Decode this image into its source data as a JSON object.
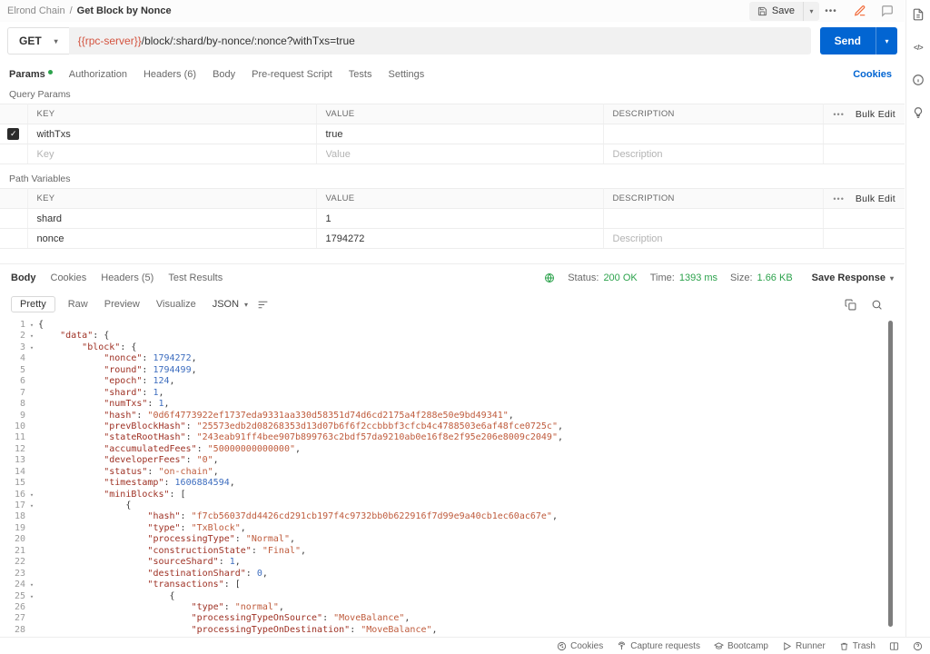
{
  "glyphs": {
    "chevron_down": "▾",
    "check": "✓"
  },
  "header": {
    "collection": "Elrond Chain",
    "separator": "/",
    "request_name": "Get Block by Nonce",
    "save_label": "Save",
    "more_label": "•••"
  },
  "request": {
    "method": "GET",
    "url_variable": "{{rpc-server}}",
    "url_path": "/block/:shard/by-nonce/:nonce?withTxs=true",
    "send_label": "Send",
    "cookies_link": "Cookies"
  },
  "request_tabs": [
    {
      "label": "Params",
      "active": true
    },
    {
      "label": "Authorization",
      "active": false
    },
    {
      "label": "Headers (6)",
      "active": false
    },
    {
      "label": "Body",
      "active": false
    },
    {
      "label": "Pre-request Script",
      "active": false
    },
    {
      "label": "Tests",
      "active": false
    },
    {
      "label": "Settings",
      "active": false
    }
  ],
  "query_params": {
    "title": "Query Params",
    "col_key": "KEY",
    "col_value": "VALUE",
    "col_description": "DESCRIPTION",
    "more_label": "•••",
    "bulk_edit_label": "Bulk Edit",
    "rows": [
      {
        "key": "withTxs",
        "value": "true",
        "description": "",
        "checked": true
      }
    ],
    "placeholders": {
      "key": "Key",
      "value": "Value",
      "description": "Description"
    }
  },
  "path_variables": {
    "title": "Path Variables",
    "col_key": "KEY",
    "col_value": "VALUE",
    "col_description": "DESCRIPTION",
    "more_label": "•••",
    "bulk_edit_label": "Bulk Edit",
    "rows": [
      {
        "key": "shard",
        "value": "1",
        "description": ""
      },
      {
        "key": "nonce",
        "value": "1794272",
        "description_placeholder": "Description"
      }
    ]
  },
  "response": {
    "tabs": [
      {
        "label": "Body",
        "active": true
      },
      {
        "label": "Cookies",
        "active": false
      },
      {
        "label": "Headers (5)",
        "active": false
      },
      {
        "label": "Test Results",
        "active": false
      }
    ],
    "status_label": "Status:",
    "status_value": "200 OK",
    "time_label": "Time:",
    "time_value": "1393 ms",
    "size_label": "Size:",
    "size_value": "1.66 KB",
    "save_response_label": "Save Response",
    "view_modes": [
      "Pretty",
      "Raw",
      "Preview",
      "Visualize"
    ],
    "active_view": "Pretty",
    "format": "JSON"
  },
  "colors": {
    "accent_blue": "#0265d2",
    "success_green": "#2ca24c",
    "variable_orange": "#d3533f",
    "json_key": "#9e3023",
    "json_string": "#bf5b3c",
    "json_number": "#3d6dbf"
  },
  "response_body": {
    "lines": [
      {
        "n": 1,
        "fold": true,
        "t": [
          [
            "p",
            "{"
          ]
        ]
      },
      {
        "n": 2,
        "fold": true,
        "t": [
          [
            "w",
            "    "
          ],
          [
            "k",
            "\"data\""
          ],
          [
            "p",
            ": {"
          ]
        ]
      },
      {
        "n": 3,
        "fold": true,
        "t": [
          [
            "w",
            "        "
          ],
          [
            "k",
            "\"block\""
          ],
          [
            "p",
            ": {"
          ]
        ]
      },
      {
        "n": 4,
        "t": [
          [
            "w",
            "            "
          ],
          [
            "k",
            "\"nonce\""
          ],
          [
            "p",
            ": "
          ],
          [
            "n",
            "1794272"
          ],
          [
            "p",
            ","
          ]
        ]
      },
      {
        "n": 5,
        "t": [
          [
            "w",
            "            "
          ],
          [
            "k",
            "\"round\""
          ],
          [
            "p",
            ": "
          ],
          [
            "n",
            "1794499"
          ],
          [
            "p",
            ","
          ]
        ]
      },
      {
        "n": 6,
        "t": [
          [
            "w",
            "            "
          ],
          [
            "k",
            "\"epoch\""
          ],
          [
            "p",
            ": "
          ],
          [
            "n",
            "124"
          ],
          [
            "p",
            ","
          ]
        ]
      },
      {
        "n": 7,
        "t": [
          [
            "w",
            "            "
          ],
          [
            "k",
            "\"shard\""
          ],
          [
            "p",
            ": "
          ],
          [
            "n",
            "1"
          ],
          [
            "p",
            ","
          ]
        ]
      },
      {
        "n": 8,
        "t": [
          [
            "w",
            "            "
          ],
          [
            "k",
            "\"numTxs\""
          ],
          [
            "p",
            ": "
          ],
          [
            "n",
            "1"
          ],
          [
            "p",
            ","
          ]
        ]
      },
      {
        "n": 9,
        "t": [
          [
            "w",
            "            "
          ],
          [
            "k",
            "\"hash\""
          ],
          [
            "p",
            ": "
          ],
          [
            "s",
            "\"0d6f4773922ef1737eda9331aa330d58351d74d6cd2175a4f288e50e9bd49341\""
          ],
          [
            "p",
            ","
          ]
        ]
      },
      {
        "n": 10,
        "t": [
          [
            "w",
            "            "
          ],
          [
            "k",
            "\"prevBlockHash\""
          ],
          [
            "p",
            ": "
          ],
          [
            "s",
            "\"25573edb2d08268353d13d07b6f6f2ccbbbf3cfcb4c4788503e6af48fce0725c\""
          ],
          [
            "p",
            ","
          ]
        ]
      },
      {
        "n": 11,
        "t": [
          [
            "w",
            "            "
          ],
          [
            "k",
            "\"stateRootHash\""
          ],
          [
            "p",
            ": "
          ],
          [
            "s",
            "\"243eab91ff4bee907b899763c2bdf57da9210ab0e16f8e2f95e206e8009c2049\""
          ],
          [
            "p",
            ","
          ]
        ]
      },
      {
        "n": 12,
        "t": [
          [
            "w",
            "            "
          ],
          [
            "k",
            "\"accumulatedFees\""
          ],
          [
            "p",
            ": "
          ],
          [
            "s",
            "\"50000000000000\""
          ],
          [
            "p",
            ","
          ]
        ]
      },
      {
        "n": 13,
        "t": [
          [
            "w",
            "            "
          ],
          [
            "k",
            "\"developerFees\""
          ],
          [
            "p",
            ": "
          ],
          [
            "s",
            "\"0\""
          ],
          [
            "p",
            ","
          ]
        ]
      },
      {
        "n": 14,
        "t": [
          [
            "w",
            "            "
          ],
          [
            "k",
            "\"status\""
          ],
          [
            "p",
            ": "
          ],
          [
            "s",
            "\"on-chain\""
          ],
          [
            "p",
            ","
          ]
        ]
      },
      {
        "n": 15,
        "t": [
          [
            "w",
            "            "
          ],
          [
            "k",
            "\"timestamp\""
          ],
          [
            "p",
            ": "
          ],
          [
            "n",
            "1606884594"
          ],
          [
            "p",
            ","
          ]
        ]
      },
      {
        "n": 16,
        "fold": true,
        "t": [
          [
            "w",
            "            "
          ],
          [
            "k",
            "\"miniBlocks\""
          ],
          [
            "p",
            ": ["
          ]
        ]
      },
      {
        "n": 17,
        "fold": true,
        "t": [
          [
            "w",
            "                "
          ],
          [
            "p",
            "{"
          ]
        ]
      },
      {
        "n": 18,
        "t": [
          [
            "w",
            "                    "
          ],
          [
            "k",
            "\"hash\""
          ],
          [
            "p",
            ": "
          ],
          [
            "s",
            "\"f7cb56037dd4426cd291cb197f4c9732bb0b622916f7d99e9a40cb1ec60ac67e\""
          ],
          [
            "p",
            ","
          ]
        ]
      },
      {
        "n": 19,
        "t": [
          [
            "w",
            "                    "
          ],
          [
            "k",
            "\"type\""
          ],
          [
            "p",
            ": "
          ],
          [
            "s",
            "\"TxBlock\""
          ],
          [
            "p",
            ","
          ]
        ]
      },
      {
        "n": 20,
        "t": [
          [
            "w",
            "                    "
          ],
          [
            "k",
            "\"processingType\""
          ],
          [
            "p",
            ": "
          ],
          [
            "s",
            "\"Normal\""
          ],
          [
            "p",
            ","
          ]
        ]
      },
      {
        "n": 21,
        "t": [
          [
            "w",
            "                    "
          ],
          [
            "k",
            "\"constructionState\""
          ],
          [
            "p",
            ": "
          ],
          [
            "s",
            "\"Final\""
          ],
          [
            "p",
            ","
          ]
        ]
      },
      {
        "n": 22,
        "t": [
          [
            "w",
            "                    "
          ],
          [
            "k",
            "\"sourceShard\""
          ],
          [
            "p",
            ": "
          ],
          [
            "n",
            "1"
          ],
          [
            "p",
            ","
          ]
        ]
      },
      {
        "n": 23,
        "t": [
          [
            "w",
            "                    "
          ],
          [
            "k",
            "\"destinationShard\""
          ],
          [
            "p",
            ": "
          ],
          [
            "n",
            "0"
          ],
          [
            "p",
            ","
          ]
        ]
      },
      {
        "n": 24,
        "fold": true,
        "t": [
          [
            "w",
            "                    "
          ],
          [
            "k",
            "\"transactions\""
          ],
          [
            "p",
            ": ["
          ]
        ]
      },
      {
        "n": 25,
        "fold": true,
        "t": [
          [
            "w",
            "                        "
          ],
          [
            "p",
            "{"
          ]
        ]
      },
      {
        "n": 26,
        "t": [
          [
            "w",
            "                            "
          ],
          [
            "k",
            "\"type\""
          ],
          [
            "p",
            ": "
          ],
          [
            "s",
            "\"normal\""
          ],
          [
            "p",
            ","
          ]
        ]
      },
      {
        "n": 27,
        "t": [
          [
            "w",
            "                            "
          ],
          [
            "k",
            "\"processingTypeOnSource\""
          ],
          [
            "p",
            ": "
          ],
          [
            "s",
            "\"MoveBalance\""
          ],
          [
            "p",
            ","
          ]
        ]
      },
      {
        "n": 28,
        "t": [
          [
            "w",
            "                            "
          ],
          [
            "k",
            "\"processingTypeOnDestination\""
          ],
          [
            "p",
            ": "
          ],
          [
            "s",
            "\"MoveBalance\""
          ],
          [
            "p",
            ","
          ]
        ]
      }
    ]
  },
  "footer": {
    "items": [
      {
        "icon": "cookie-icon",
        "label": "Cookies"
      },
      {
        "icon": "capture-icon",
        "label": "Capture requests"
      },
      {
        "icon": "bootcamp-icon",
        "label": "Bootcamp"
      },
      {
        "icon": "runner-icon",
        "label": "Runner"
      },
      {
        "icon": "trash-icon",
        "label": "Trash"
      }
    ]
  },
  "right_rail": {
    "icons": [
      "documentation-icon",
      "code-icon",
      "info-icon",
      "lightbulb-icon"
    ]
  }
}
